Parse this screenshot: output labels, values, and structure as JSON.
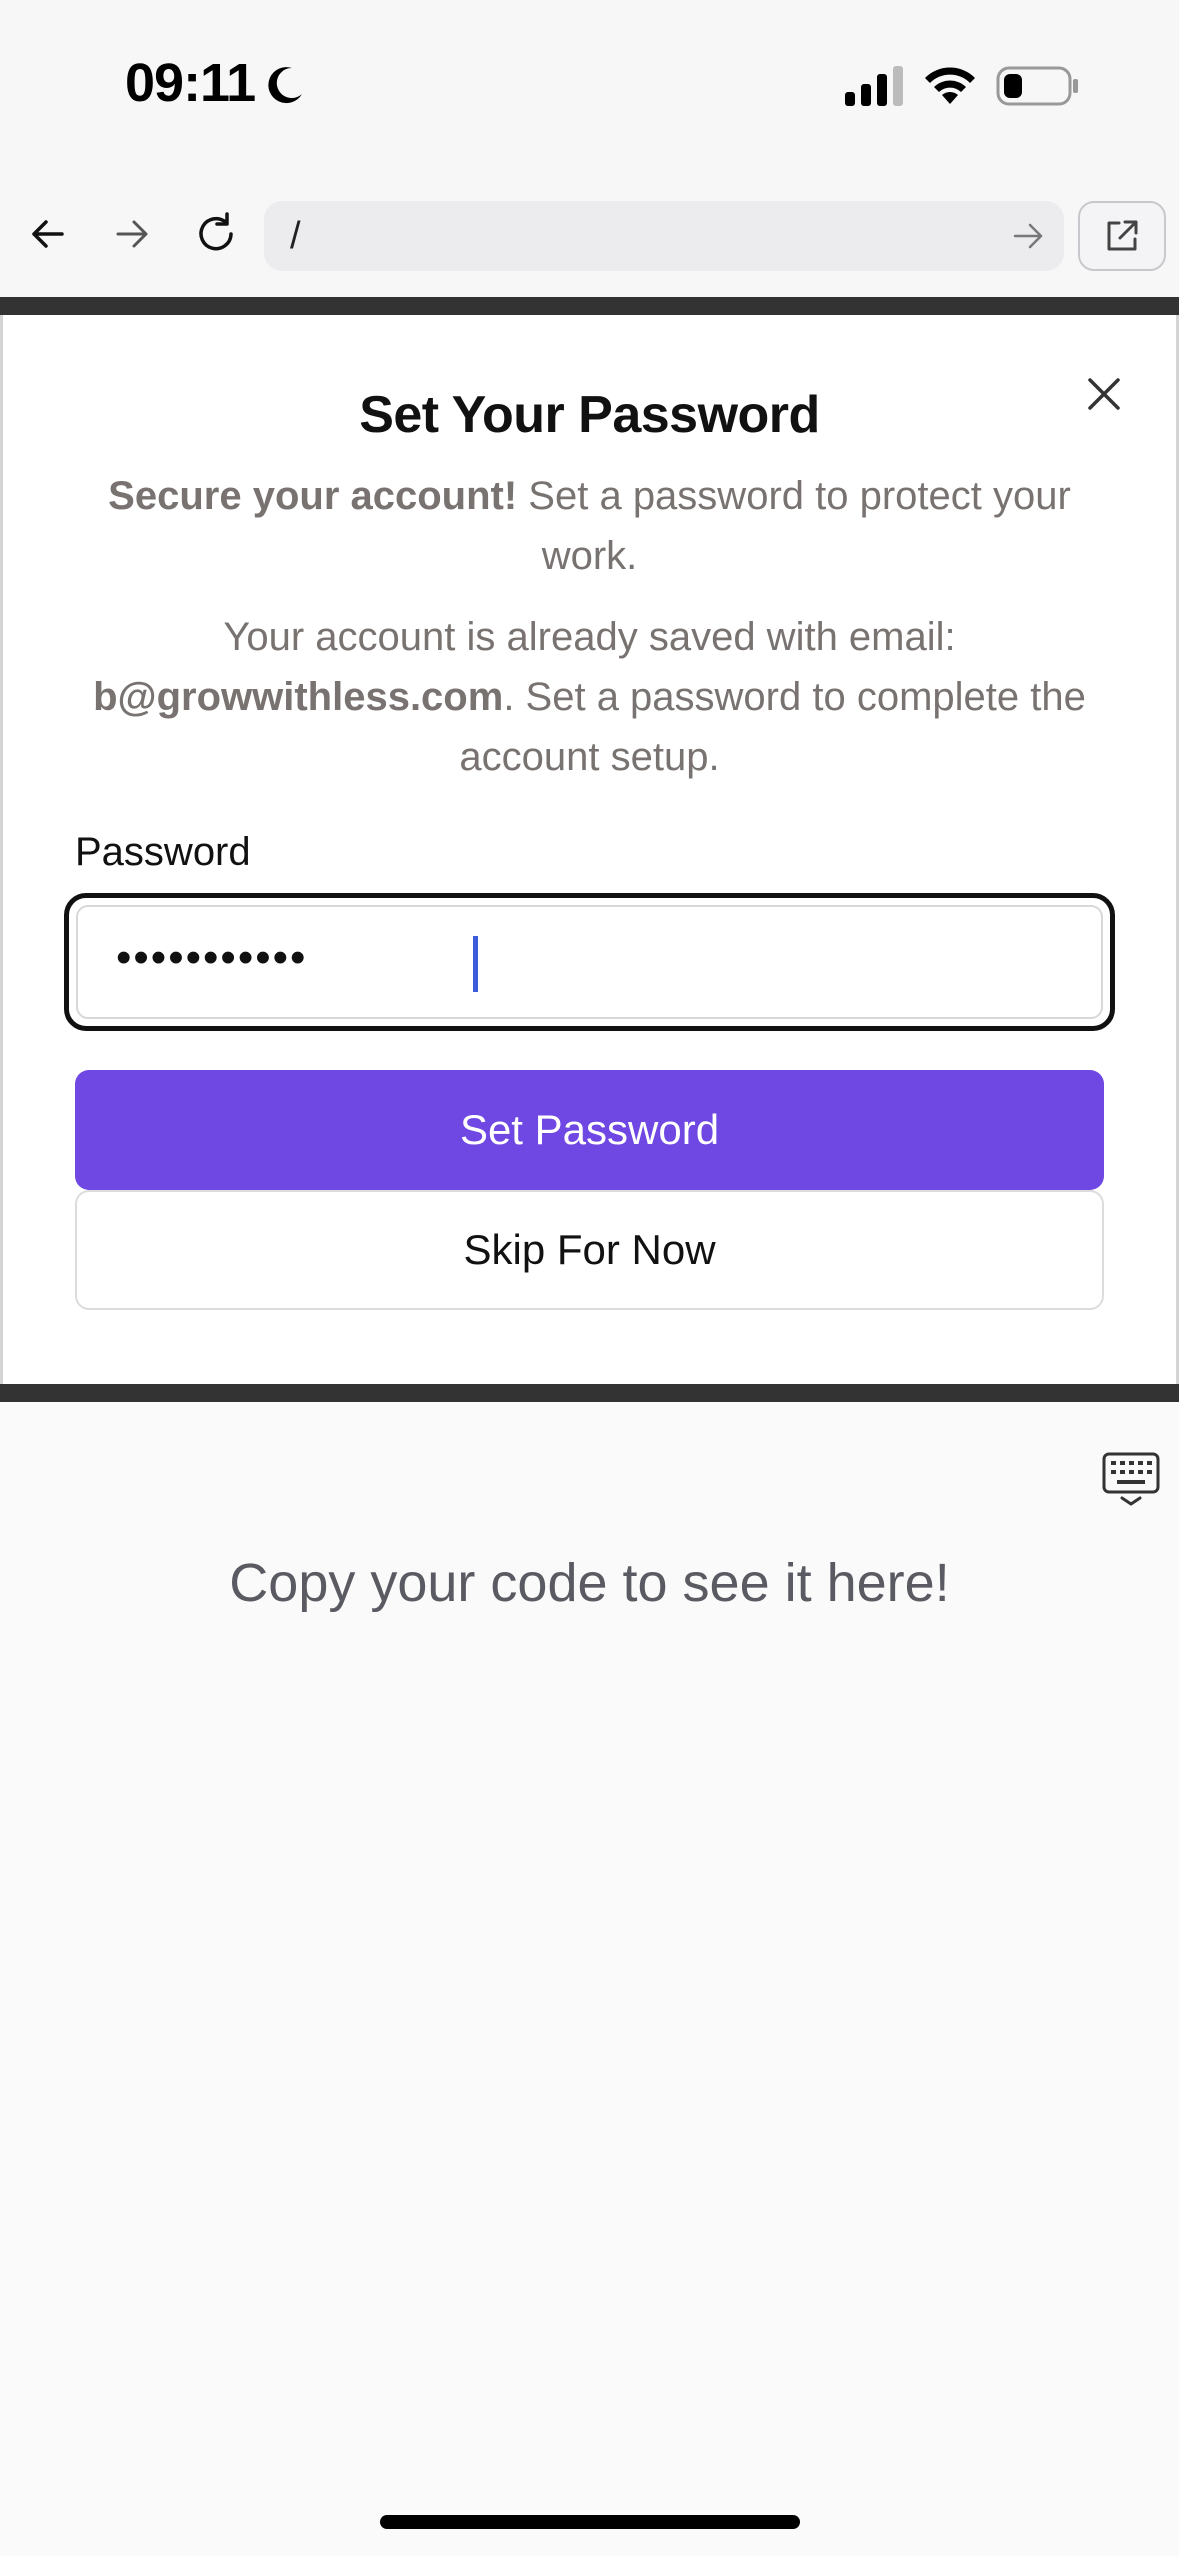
{
  "status_bar": {
    "time": "09:11",
    "icons": [
      "moon-icon",
      "cellular-signal-icon",
      "wifi-icon",
      "battery-icon"
    ]
  },
  "browser": {
    "url": "/",
    "buttons": [
      "back-icon",
      "forward-icon",
      "reload-icon",
      "url-go-icon",
      "open-external-icon"
    ]
  },
  "modal": {
    "title": "Set Your Password",
    "subtitle_bold": "Secure your account!",
    "subtitle_rest": " Set a password to protect your work.",
    "info_prefix": "Your account is already saved with email: ",
    "info_email": "b@growwithless.com",
    "info_suffix": ". Set a password to complete the account setup.",
    "password_label": "Password",
    "password_value": "•••••••••••",
    "set_button": "Set Password",
    "skip_button": "Skip For Now"
  },
  "preview": {
    "message": "Copy your code to see it here!"
  },
  "colors": {
    "accent": "#6f47e3",
    "caret": "#3b5bdb",
    "muted_text": "#787370",
    "frame": "#333333"
  }
}
